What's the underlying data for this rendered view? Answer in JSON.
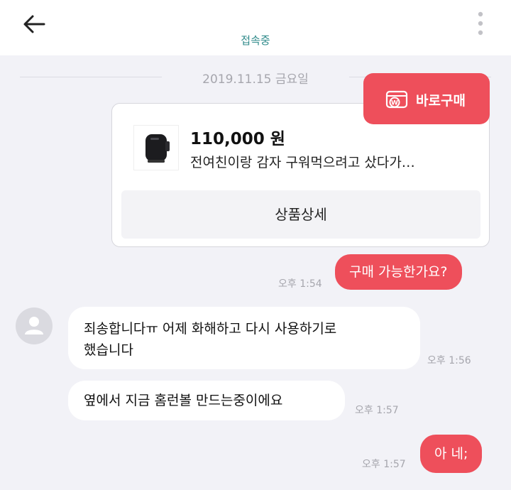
{
  "header": {
    "status": "접속중"
  },
  "conversation": {
    "date_divider": "2019.11.15 금요일"
  },
  "product_card": {
    "price": "110,000 원",
    "description": "전여친이랑 감자 구워먹으려고 샀다가…",
    "detail_button": "상품상세",
    "buy_button": "바로구매"
  },
  "messages": [
    {
      "sender": "me",
      "text": "구매 가능한가요?",
      "time": "오후 1:54"
    },
    {
      "sender": "other",
      "line1": "죄송합니다ㅠ 어제 화해하고 다시 사용하기로",
      "line2": "했습니다",
      "time": "오후 1:56"
    },
    {
      "sender": "other",
      "text": "옆에서 지금 홈런볼 만드는중이에요",
      "time": "오후 1:57"
    },
    {
      "sender": "me",
      "text": "아 네;",
      "time": "오후 1:57"
    }
  ],
  "colors": {
    "accent": "#ee4f5b",
    "status": "#2e8a8a",
    "background": "#f2f2f7"
  }
}
